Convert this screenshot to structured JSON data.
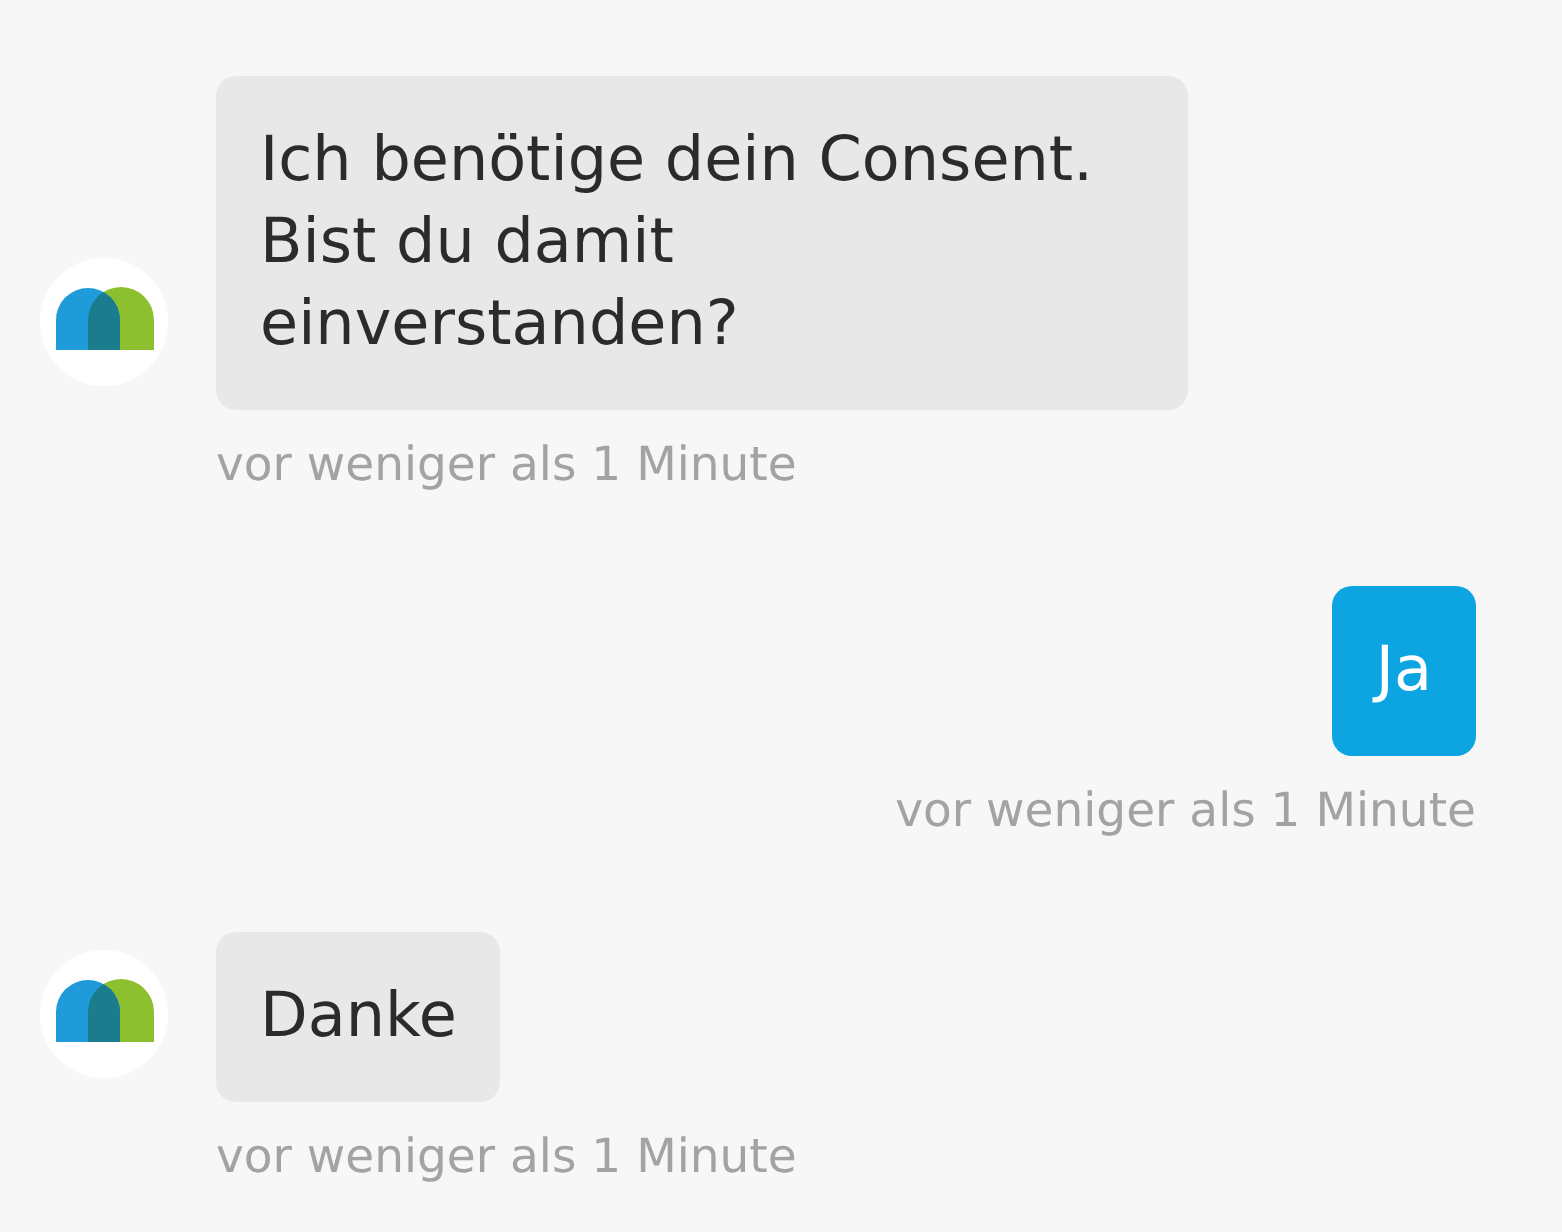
{
  "messages": [
    {
      "kind": "bot",
      "text": "Ich benötige dein Consent. Bist du damit einverstanden?",
      "time": "vor weniger als 1 Minute"
    },
    {
      "kind": "user",
      "text": "Ja",
      "time": "vor weniger als 1 Minute"
    },
    {
      "kind": "bot",
      "text": "Danke",
      "time": "vor weniger als 1 Minute"
    }
  ]
}
